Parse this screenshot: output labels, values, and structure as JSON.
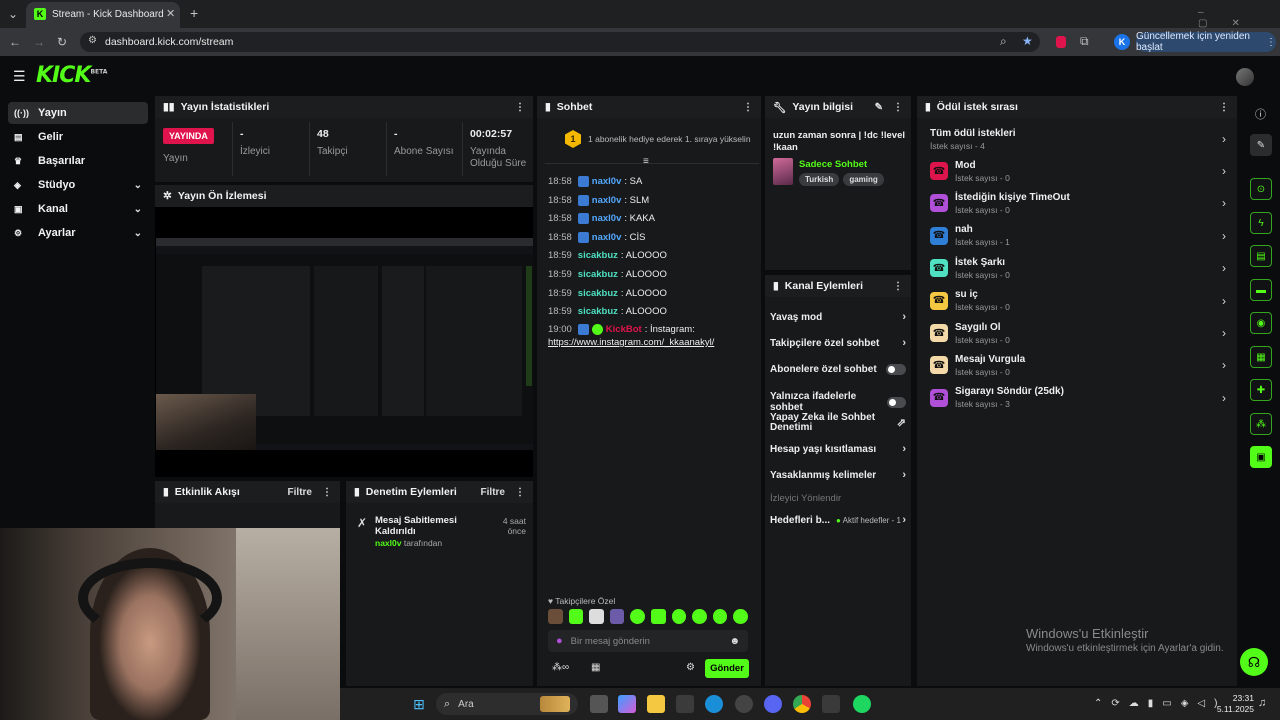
{
  "browser": {
    "tab_title": "Stream - Kick Dashboard",
    "url": "dashboard.kick.com/stream",
    "update_label": "Güncellemek için yeniden başlat",
    "profile_initial": "K"
  },
  "app": {
    "logo": "KICK",
    "logo_sup": "BETA"
  },
  "sidebar": {
    "items": [
      {
        "label": "Yayın",
        "icon": "broadcast-icon"
      },
      {
        "label": "Gelir",
        "icon": "income-icon"
      },
      {
        "label": "Başarılar",
        "icon": "trophy-icon"
      },
      {
        "label": "Stüdyo",
        "icon": "studio-icon"
      },
      {
        "label": "Kanal",
        "icon": "channel-icon"
      },
      {
        "label": "Ayarlar",
        "icon": "gear-icon"
      }
    ]
  },
  "stats": {
    "title": "Yayın İstatistikleri",
    "live_label": "YAYINDA",
    "status_label": "Yayın",
    "viewers_value": "-",
    "viewers_label": "İzleyici",
    "followers_value": "48",
    "followers_label": "Takipçi",
    "subs_value": "-",
    "subs_label": "Abone Sayısı",
    "duration_value": "00:02:57",
    "duration_label": "Yayında Olduğu Süre"
  },
  "preview": {
    "title": "Yayın Ön İzlemesi"
  },
  "activity": {
    "title": "Etkinlik Akışı",
    "filter": "Filtre"
  },
  "moderation": {
    "title": "Denetim Eylemleri",
    "filter": "Filtre",
    "entry_title": "Mesaj Sabitlemesi Kaldırıldı",
    "entry_time": "4 saat önce",
    "entry_user": "naxl0v",
    "entry_suffix": "tarafından"
  },
  "chat": {
    "title": "Sohbet",
    "rank_badge": "1",
    "banner": "1 abonelik hediye ederek 1. sıraya yükselin",
    "messages": [
      {
        "time": "18:58",
        "user": "naxl0v",
        "text": ": SA",
        "color": "#53a8ff"
      },
      {
        "time": "18:58",
        "user": "naxl0v",
        "text": ": SLM",
        "color": "#53a8ff"
      },
      {
        "time": "18:58",
        "user": "naxl0v",
        "text": ": KAKA",
        "color": "#53a8ff"
      },
      {
        "time": "18:58",
        "user": "naxl0v",
        "text": ": CİS",
        "color": "#53a8ff"
      },
      {
        "time": "18:59",
        "user": "sicakbuz",
        "text": ": ALOOOO",
        "color": "#4ee0c0"
      },
      {
        "time": "18:59",
        "user": "sicakbuz",
        "text": ": ALOOOO",
        "color": "#4ee0c0"
      },
      {
        "time": "18:59",
        "user": "sicakbuz",
        "text": ": ALOOOO",
        "color": "#4ee0c0"
      },
      {
        "time": "18:59",
        "user": "sicakbuz",
        "text": ": ALOOOO",
        "color": "#4ee0c0"
      }
    ],
    "bot_time": "19:00",
    "bot_user": "KickBot",
    "bot_text": ": İnstagram:",
    "bot_link": "https://www.instagram.com/_kkaanakyl/",
    "follower_only": "Takipçilere Özel",
    "input_placeholder": "Bir mesaj gönderin",
    "send_label": "Gönder"
  },
  "stream_info": {
    "title": "Yayın bilgisi",
    "stream_title": "uzun zaman sonra | !dc !level !kaan",
    "category": "Sadece Sohbet",
    "tags": [
      "Turkish",
      "gaming"
    ]
  },
  "channel_actions": {
    "title": "Kanal Eylemleri",
    "items": [
      {
        "label": "Yavaş mod",
        "type": "arrow"
      },
      {
        "label": "Takipçilere özel sohbet",
        "type": "arrow"
      },
      {
        "label": "Abonelere özel sohbet",
        "type": "toggle"
      },
      {
        "label": "Yalnızca ifadelerle sohbet",
        "type": "toggle"
      },
      {
        "label": "Yapay Zeka ile Sohbet Denetimi",
        "type": "external"
      },
      {
        "label": "Hesap yaşı kısıtlaması",
        "type": "arrow"
      },
      {
        "label": "Yasaklanmış kelimeler",
        "type": "arrow"
      }
    ],
    "section_label": "İzleyici Yönlendir",
    "goals_label": "Hedefleri b...",
    "goals_status": "Aktif hedefler - 1"
  },
  "rewards": {
    "title": "Ödül istek sırası",
    "all_label": "Tüm ödül istekleri",
    "all_count": "İstek sayısı - 4",
    "items": [
      {
        "name": "Mod",
        "count": "İstek sayısı - 0",
        "color": "#e0144c"
      },
      {
        "name": "İstediğin kişiye TimeOut",
        "count": "İstek sayısı - 0",
        "color": "#b04fd8"
      },
      {
        "name": "nah",
        "count": "İstek sayısı - 1",
        "color": "#2f7fd6"
      },
      {
        "name": "İstek Şarkı",
        "count": "İstek sayısı - 0",
        "color": "#4ee0c0"
      },
      {
        "name": "su iç",
        "count": "İstek sayısı - 0",
        "color": "#f5c842"
      },
      {
        "name": "Saygılı Ol",
        "count": "İstek sayısı - 0",
        "color": "#f3d9a8"
      },
      {
        "name": "Mesajı Vurgula",
        "count": "İstek sayısı - 0",
        "color": "#f3d9a8"
      },
      {
        "name": "Sigarayı Söndür (25dk)",
        "count": "İstek sayısı - 3",
        "color": "#b04fd8"
      }
    ]
  },
  "windows": {
    "activate_title": "Windows'u Etkinleştir",
    "activate_sub": "Windows'u etkinleştirmek için Ayarlar'a gidin.",
    "search_label": "Ara",
    "time": "23:31",
    "date": "5.11.2025"
  },
  "colors": {
    "kick_green": "#53fc18",
    "live_red": "#e0144c",
    "panel": "#18191b"
  }
}
